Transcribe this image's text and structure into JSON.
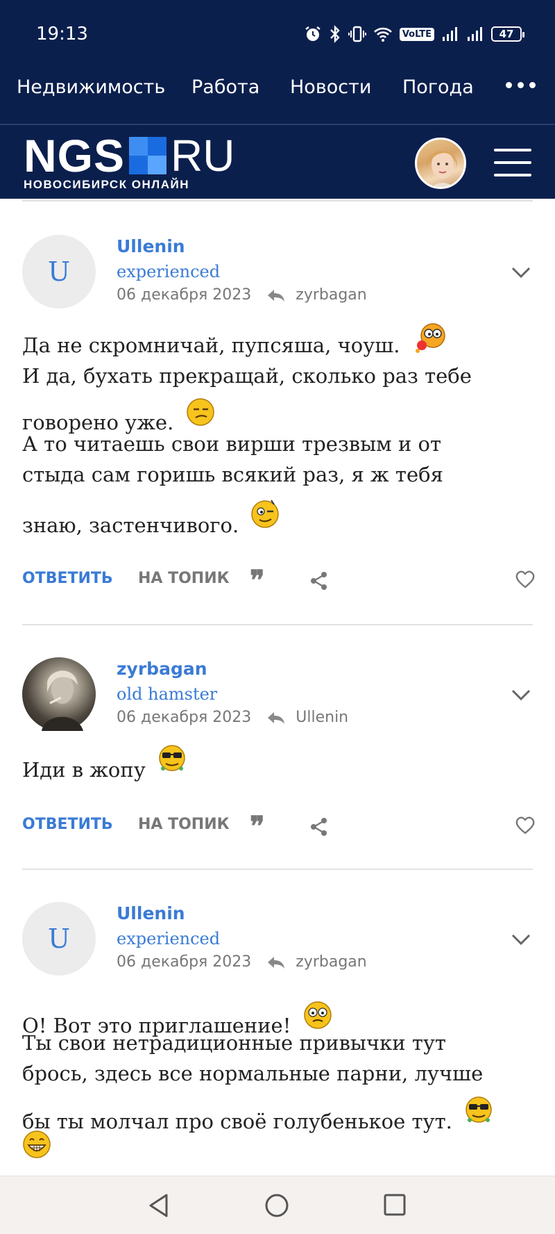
{
  "status_bar": {
    "time": "19:13",
    "volte_label": "VoLTE",
    "battery_level": "47"
  },
  "top_nav": {
    "items": [
      "Недвижимость",
      "Работа",
      "Новости",
      "Погода"
    ]
  },
  "brand": {
    "logo_main": "NGS",
    "logo_domain": "RU",
    "logo_subtitle": "НОВОСИБИРСК ОНЛАЙН"
  },
  "actions": {
    "reply": "ОТВЕТИТЬ",
    "to_topic": "НА ТОПИК",
    "quote_glyph": "❞"
  },
  "comments": [
    {
      "avatar_letter": "U",
      "author": "Ullenin",
      "rank": "experienced",
      "date": "06 декабря 2023",
      "reply_to": "zyrbagan",
      "lines": [
        "Да не скромничай, пупсяша, чоуш.",
        "И да, бухать прекращай, сколько раз тебе",
        "говорено уже.",
        "А то читаешь свои вирши трезвым и от",
        "стыда сам горишь всякий раз, я ж тебя",
        "знаю, застенчивого."
      ]
    },
    {
      "avatar_letter": "",
      "author": "zyrbagan",
      "rank": "old hamster",
      "date": "06 декабря 2023",
      "reply_to": "Ullenin",
      "lines": [
        "Иди в жопу"
      ]
    },
    {
      "avatar_letter": "U",
      "author": "Ullenin",
      "rank": "experienced",
      "date": "06 декабря 2023",
      "reply_to": "zyrbagan",
      "lines": [
        "О! Вот это приглашение!",
        "Ты свои нетрадиционные привычки тут",
        "брось, здесь все нормальные парни, лучше",
        "бы ты молчал про своё голубенькое тут."
      ]
    }
  ],
  "icons": {
    "status": [
      "alarm-icon",
      "bluetooth-icon",
      "vibrate-icon",
      "wifi-icon",
      "signal-icon",
      "signal-icon",
      "battery-icon"
    ],
    "nav": [
      "more-dots-icon",
      "hamburger-menu-icon"
    ],
    "comment": [
      "chevron-down-icon",
      "reply-arrow-icon",
      "quote-icon",
      "share-icon",
      "heart-icon"
    ],
    "android": [
      "back-icon",
      "home-icon",
      "recents-icon"
    ]
  },
  "colors": {
    "header_bg": "#0b1f4d",
    "accent": "#3a7bd5",
    "text": "#222222",
    "muted": "#777777"
  }
}
